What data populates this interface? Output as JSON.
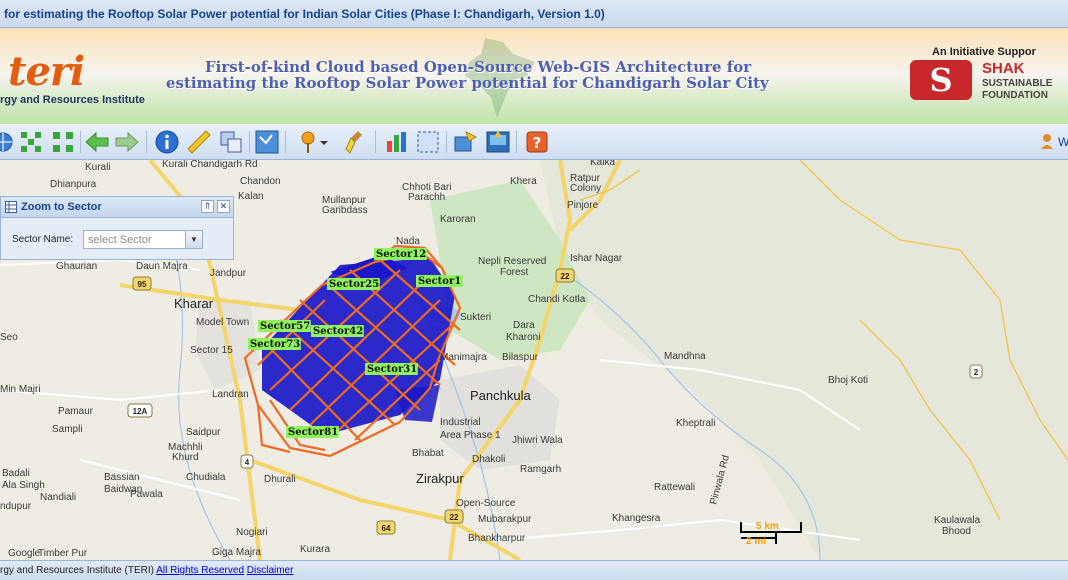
{
  "window": {
    "title": "for estimating the Rooftop Solar Power potential for Indian Solar Cities (Phase I: Chandigarh, Version 1.0)"
  },
  "banner": {
    "logo_text": "teri",
    "logo_subtitle": "rgy and Resources Institute",
    "heading_line1": "First-of-kind Cloud based Open-Source Web-GIS Architecture for",
    "heading_line2": "estimating the Rooftop Solar Power potential for Chandigarh Solar City",
    "initiative_text": "An Initiative Suppor",
    "partner_mark": "S",
    "partner_name": "SHAK",
    "partner_sub": "SUSTAINABLE\nFOUNDATION"
  },
  "toolbar": {
    "user_label": "W",
    "icons": [
      "globe-icon",
      "zoom-extent-icon",
      "zoom-in-icon",
      "back-arrow-icon",
      "forward-arrow-icon",
      "info-icon",
      "measure-ruler-icon",
      "layers-icon",
      "identify-icon",
      "pushpin-icon",
      "dropdown-arrow-icon",
      "clear-brush-icon",
      "chart-icon",
      "select-box-icon",
      "query-icon",
      "layout-icon",
      "help-icon"
    ]
  },
  "zoom_panel": {
    "title": "Zoom to Sector",
    "collapse_symbol": "⇑",
    "close_symbol": "✕",
    "field_label": "Sector Name:",
    "select_placeholder": "select Sector",
    "arrow_symbol": "▼"
  },
  "map": {
    "place_labels": [
      "Kurali",
      "Kurali Chandigarh Rd",
      "Dhianpura",
      "Chandon",
      "Kalan",
      "Mullanpur",
      "Garibdass",
      "Chhoti Bari",
      "Parachh",
      "Karoran",
      "Nada",
      "Kalka",
      "Ratpur",
      "Colony",
      "Pinjore",
      "Khera",
      "Ishar Nagar",
      "Nepli Reserved",
      "Forest",
      "Chandi Kotla",
      "Sukteri",
      "Dara",
      "Kharoni",
      "Bilaspur",
      "Manimajra",
      "Mandhna",
      "Bhoj Koti",
      "Ghaurian",
      "Daun Majra",
      "Jandpur",
      "Model Town",
      "Sector 15",
      "Landran",
      "Min Majri",
      "Pamaur",
      "Sampli",
      "Saidpur",
      "Machhli",
      "Khurd",
      "Chudiala",
      "Dhurali",
      "Badali",
      "Ala Singh",
      "Bassian",
      "Baidwan",
      "Nandiali",
      "Pawala",
      "ndupur",
      "Nogiari",
      "Giga Majra",
      "Kurara",
      "Timber Pur",
      "Bhabat",
      "Dhakoli",
      "Industrial",
      "Area Phase 1",
      "Jhiwri Wala",
      "Ramgarh",
      "Kheptrali",
      "Rattewali",
      "Khangesra",
      "Mubarakpur",
      "Bhankharpur",
      "Open-Source",
      "Pinwala Rd",
      "Kaulawala",
      "Bhood",
      "Google",
      "Seo"
    ],
    "town_labels": [
      "Kharar",
      "Panchkula",
      "Zirakpur"
    ],
    "road_badges": [
      "95",
      "22",
      "12A",
      "4",
      "64",
      "22",
      "2"
    ],
    "sector_labels": [
      "Sector12",
      "Sector1",
      "Sector25",
      "Sector57",
      "Sector42",
      "Sector73",
      "Sector31",
      "Sector81"
    ],
    "scale_km": "5 km",
    "scale_mi": "2 mi",
    "highlight_color": "#8ff25f",
    "sector_outline_color": "#ee6a22",
    "building_color": "#1a18c8"
  },
  "footer": {
    "org_text": "rgy and Resources Institute (TERI)",
    "rights_link": "All Rights Reserved",
    "disclaimer_link": "Disclaimer"
  }
}
